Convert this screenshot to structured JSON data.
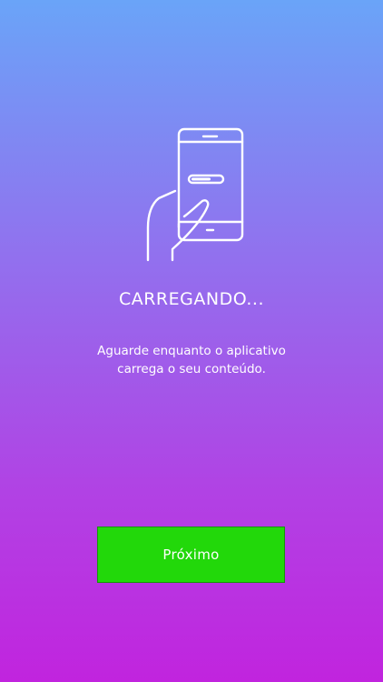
{
  "onboarding": {
    "illustration_icon": "hand-holding-phone-loading-icon",
    "title": "CARREGANDO...",
    "description_line1": "Aguarde enquanto o aplicativo",
    "description_line2": "carrega o seu conteúdo.",
    "next_button_label": "Próximo"
  },
  "colors": {
    "gradient_top": "#6aa4f8",
    "gradient_bottom": "#c124de",
    "button_background": "#22d80a",
    "text": "#ffffff"
  }
}
